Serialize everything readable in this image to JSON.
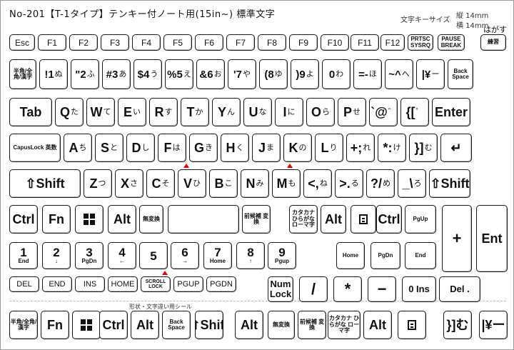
{
  "header": {
    "title": "No-201【T-1タイプ】テンキー付ノート用(15in~) 標準文字",
    "size_label": "文字キーサイズ",
    "size_w": "縦 14mm",
    "size_h": "横 14mm",
    "peel": "はがす"
  },
  "footer": "形状・文字違い用シール",
  "rows": {
    "row1": [
      "Esc",
      "F1",
      "F2",
      "F3",
      "F4",
      "F5",
      "F6",
      "F7",
      "F8",
      "F9",
      "F10",
      "F11",
      "F12",
      "PRTSC SYSRQ",
      "PAUSE BREAK",
      "練習"
    ],
    "row2": [
      {
        "m": "半角/全角/漢字"
      },
      {
        "m": "!1",
        "k": "ぬ"
      },
      {
        "m": "\"2",
        "k": "ふ"
      },
      {
        "m": "#3",
        "k": "あ"
      },
      {
        "m": "$4",
        "k": "う"
      },
      {
        "m": "%5",
        "k": "え"
      },
      {
        "m": "&6",
        "k": "お"
      },
      {
        "m": "'7",
        "k": "や"
      },
      {
        "m": "(8",
        "k": "ゆ"
      },
      {
        "m": ")9",
        "k": "よ"
      },
      {
        "m": "0",
        "k": "わ"
      },
      {
        "m": "=-",
        "k": "ほ"
      },
      {
        "m": "~^",
        "k": "へ"
      },
      {
        "m": "|¥",
        "k": "ー"
      },
      {
        "m": "Back Space"
      }
    ],
    "row3": [
      {
        "m": "Tab"
      },
      {
        "m": "Q",
        "k": "た"
      },
      {
        "m": "W",
        "k": "て"
      },
      {
        "m": "E",
        "k": "い"
      },
      {
        "m": "R",
        "k": "す"
      },
      {
        "m": "T",
        "k": "か"
      },
      {
        "m": "Y",
        "k": "ん"
      },
      {
        "m": "U",
        "k": "な"
      },
      {
        "m": "I",
        "k": "に"
      },
      {
        "m": "O",
        "k": "ら"
      },
      {
        "m": "P",
        "k": "せ"
      },
      {
        "m": "`@",
        "k": "゛"
      },
      {
        "m": "{[",
        "k": "゜"
      },
      {
        "m": "Enter"
      }
    ],
    "row4": [
      {
        "m": "CapusLock 英数"
      },
      {
        "m": "A",
        "k": "ち"
      },
      {
        "m": "S",
        "k": "と"
      },
      {
        "m": "D",
        "k": "し"
      },
      {
        "m": "F",
        "k": "は"
      },
      {
        "m": "G",
        "k": "き"
      },
      {
        "m": "H",
        "k": "く"
      },
      {
        "m": "J",
        "k": "ま"
      },
      {
        "m": "K",
        "k": "の"
      },
      {
        "m": "L",
        "k": "り"
      },
      {
        "m": "+;",
        "k": "れ"
      },
      {
        "m": "*:",
        "k": "け"
      },
      {
        "m": "}]",
        "k": "む"
      },
      {
        "m": "↵"
      }
    ],
    "row5": [
      {
        "m": "⇧Shift"
      },
      {
        "m": "Z",
        "k": "つ"
      },
      {
        "m": "X",
        "k": "さ"
      },
      {
        "m": "C",
        "k": "そ"
      },
      {
        "m": "V",
        "k": "ひ"
      },
      {
        "m": "B",
        "k": "こ"
      },
      {
        "m": "N",
        "k": "み"
      },
      {
        "m": "M",
        "k": "も"
      },
      {
        "m": "<,",
        "k": "ね"
      },
      {
        "m": ">.",
        "k": "る"
      },
      {
        "m": "?/",
        "k": "め"
      },
      {
        "m": "_\\",
        "k": "ろ"
      },
      {
        "m": "⇧Shift"
      }
    ],
    "row6": [
      "Ctrl",
      "Fn",
      "windows-logo",
      "Alt",
      "無変換",
      "",
      "前候補 変換",
      "カタカナ ひらがな ローマ字",
      "Alt",
      "menu-icon",
      "Ctrl",
      "PgUp"
    ],
    "row7": [
      {
        "m": "1",
        "s": "End"
      },
      {
        "m": "2",
        "s": "↓"
      },
      {
        "m": "3",
        "s": "PgDn"
      },
      {
        "m": "4",
        "s": "←"
      },
      {
        "m": "5"
      },
      {
        "m": "6",
        "s": "→"
      },
      {
        "m": "7",
        "s": "Home"
      },
      {
        "m": "8",
        "s": "↑"
      },
      {
        "m": "9",
        "s": "Pgup"
      },
      {
        "m": "Home"
      },
      {
        "m": "PgDn"
      },
      {
        "m": "End"
      }
    ],
    "row8": [
      "DEL",
      "END",
      "INS",
      "HOME",
      "SCROLL LOCK",
      "PGUP",
      "PGDN",
      "Num Lock",
      "/",
      "*",
      "−",
      "0 Ins",
      "Del ."
    ],
    "row9": [
      "半角/全角/漢字",
      "Fn",
      "windows-logo",
      "Ctrl",
      "Alt",
      "Back Space",
      "⇧Shift",
      "Alt",
      "無変換",
      "前候補 変換",
      "カタカナ ひらがな ローマ字",
      "Alt",
      "menu-icon",
      "}]む",
      "|¥ー"
    ]
  },
  "numpad": {
    "plus": "+",
    "ent": "Ent"
  }
}
